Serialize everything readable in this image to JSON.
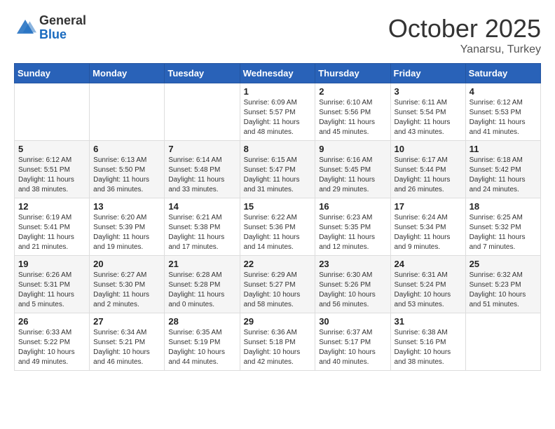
{
  "logo": {
    "general": "General",
    "blue": "Blue"
  },
  "title": "October 2025",
  "location": "Yanarsu, Turkey",
  "days_header": [
    "Sunday",
    "Monday",
    "Tuesday",
    "Wednesday",
    "Thursday",
    "Friday",
    "Saturday"
  ],
  "weeks": [
    [
      {
        "day": "",
        "info": ""
      },
      {
        "day": "",
        "info": ""
      },
      {
        "day": "",
        "info": ""
      },
      {
        "day": "1",
        "info": "Sunrise: 6:09 AM\nSunset: 5:57 PM\nDaylight: 11 hours and 48 minutes."
      },
      {
        "day": "2",
        "info": "Sunrise: 6:10 AM\nSunset: 5:56 PM\nDaylight: 11 hours and 45 minutes."
      },
      {
        "day": "3",
        "info": "Sunrise: 6:11 AM\nSunset: 5:54 PM\nDaylight: 11 hours and 43 minutes."
      },
      {
        "day": "4",
        "info": "Sunrise: 6:12 AM\nSunset: 5:53 PM\nDaylight: 11 hours and 41 minutes."
      }
    ],
    [
      {
        "day": "5",
        "info": "Sunrise: 6:12 AM\nSunset: 5:51 PM\nDaylight: 11 hours and 38 minutes."
      },
      {
        "day": "6",
        "info": "Sunrise: 6:13 AM\nSunset: 5:50 PM\nDaylight: 11 hours and 36 minutes."
      },
      {
        "day": "7",
        "info": "Sunrise: 6:14 AM\nSunset: 5:48 PM\nDaylight: 11 hours and 33 minutes."
      },
      {
        "day": "8",
        "info": "Sunrise: 6:15 AM\nSunset: 5:47 PM\nDaylight: 11 hours and 31 minutes."
      },
      {
        "day": "9",
        "info": "Sunrise: 6:16 AM\nSunset: 5:45 PM\nDaylight: 11 hours and 29 minutes."
      },
      {
        "day": "10",
        "info": "Sunrise: 6:17 AM\nSunset: 5:44 PM\nDaylight: 11 hours and 26 minutes."
      },
      {
        "day": "11",
        "info": "Sunrise: 6:18 AM\nSunset: 5:42 PM\nDaylight: 11 hours and 24 minutes."
      }
    ],
    [
      {
        "day": "12",
        "info": "Sunrise: 6:19 AM\nSunset: 5:41 PM\nDaylight: 11 hours and 21 minutes."
      },
      {
        "day": "13",
        "info": "Sunrise: 6:20 AM\nSunset: 5:39 PM\nDaylight: 11 hours and 19 minutes."
      },
      {
        "day": "14",
        "info": "Sunrise: 6:21 AM\nSunset: 5:38 PM\nDaylight: 11 hours and 17 minutes."
      },
      {
        "day": "15",
        "info": "Sunrise: 6:22 AM\nSunset: 5:36 PM\nDaylight: 11 hours and 14 minutes."
      },
      {
        "day": "16",
        "info": "Sunrise: 6:23 AM\nSunset: 5:35 PM\nDaylight: 11 hours and 12 minutes."
      },
      {
        "day": "17",
        "info": "Sunrise: 6:24 AM\nSunset: 5:34 PM\nDaylight: 11 hours and 9 minutes."
      },
      {
        "day": "18",
        "info": "Sunrise: 6:25 AM\nSunset: 5:32 PM\nDaylight: 11 hours and 7 minutes."
      }
    ],
    [
      {
        "day": "19",
        "info": "Sunrise: 6:26 AM\nSunset: 5:31 PM\nDaylight: 11 hours and 5 minutes."
      },
      {
        "day": "20",
        "info": "Sunrise: 6:27 AM\nSunset: 5:30 PM\nDaylight: 11 hours and 2 minutes."
      },
      {
        "day": "21",
        "info": "Sunrise: 6:28 AM\nSunset: 5:28 PM\nDaylight: 11 hours and 0 minutes."
      },
      {
        "day": "22",
        "info": "Sunrise: 6:29 AM\nSunset: 5:27 PM\nDaylight: 10 hours and 58 minutes."
      },
      {
        "day": "23",
        "info": "Sunrise: 6:30 AM\nSunset: 5:26 PM\nDaylight: 10 hours and 56 minutes."
      },
      {
        "day": "24",
        "info": "Sunrise: 6:31 AM\nSunset: 5:24 PM\nDaylight: 10 hours and 53 minutes."
      },
      {
        "day": "25",
        "info": "Sunrise: 6:32 AM\nSunset: 5:23 PM\nDaylight: 10 hours and 51 minutes."
      }
    ],
    [
      {
        "day": "26",
        "info": "Sunrise: 6:33 AM\nSunset: 5:22 PM\nDaylight: 10 hours and 49 minutes."
      },
      {
        "day": "27",
        "info": "Sunrise: 6:34 AM\nSunset: 5:21 PM\nDaylight: 10 hours and 46 minutes."
      },
      {
        "day": "28",
        "info": "Sunrise: 6:35 AM\nSunset: 5:19 PM\nDaylight: 10 hours and 44 minutes."
      },
      {
        "day": "29",
        "info": "Sunrise: 6:36 AM\nSunset: 5:18 PM\nDaylight: 10 hours and 42 minutes."
      },
      {
        "day": "30",
        "info": "Sunrise: 6:37 AM\nSunset: 5:17 PM\nDaylight: 10 hours and 40 minutes."
      },
      {
        "day": "31",
        "info": "Sunrise: 6:38 AM\nSunset: 5:16 PM\nDaylight: 10 hours and 38 minutes."
      },
      {
        "day": "",
        "info": ""
      }
    ]
  ]
}
